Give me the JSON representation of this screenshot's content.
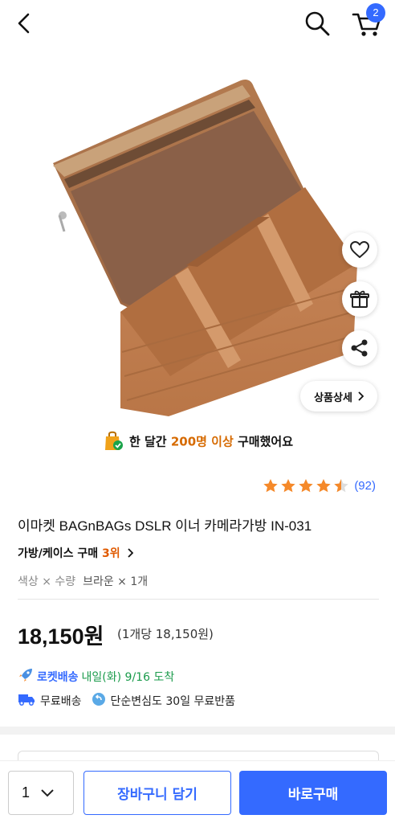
{
  "header": {
    "cart_count": "2"
  },
  "hero": {
    "detail_label": "상품상세"
  },
  "social_proof": {
    "prefix": "한 달간 ",
    "highlight": "200명 이상",
    "suffix": " 구매했어요"
  },
  "rating": {
    "stars": 4.5,
    "count": "(92)"
  },
  "product": {
    "title": "이마켓 BAGnBAGs DSLR 이너 카메라가방 IN-031",
    "category": "가방/케이스 구매 ",
    "rank": "3위",
    "option_key": "색상 × 수량",
    "option_value": "브라운 × 1개",
    "price": "18,150원",
    "unit_price": "(1개당 18,150원)"
  },
  "delivery": {
    "rocket_label": "로켓배송",
    "arrival": "내일(화) 9/16 도착",
    "free_shipping": "무료배송",
    "return_policy": "단순변심도 30일 무료반품"
  },
  "purchase_bar": {
    "quantity": "1",
    "cart_label": "장바구니 담기",
    "buy_label": "바로구매"
  },
  "colors": {
    "accent": "#346aff",
    "rank": "#e05a00",
    "highlight": "#d66a00",
    "star": "#f5892a",
    "rocket_green": "#1a9b4b"
  }
}
